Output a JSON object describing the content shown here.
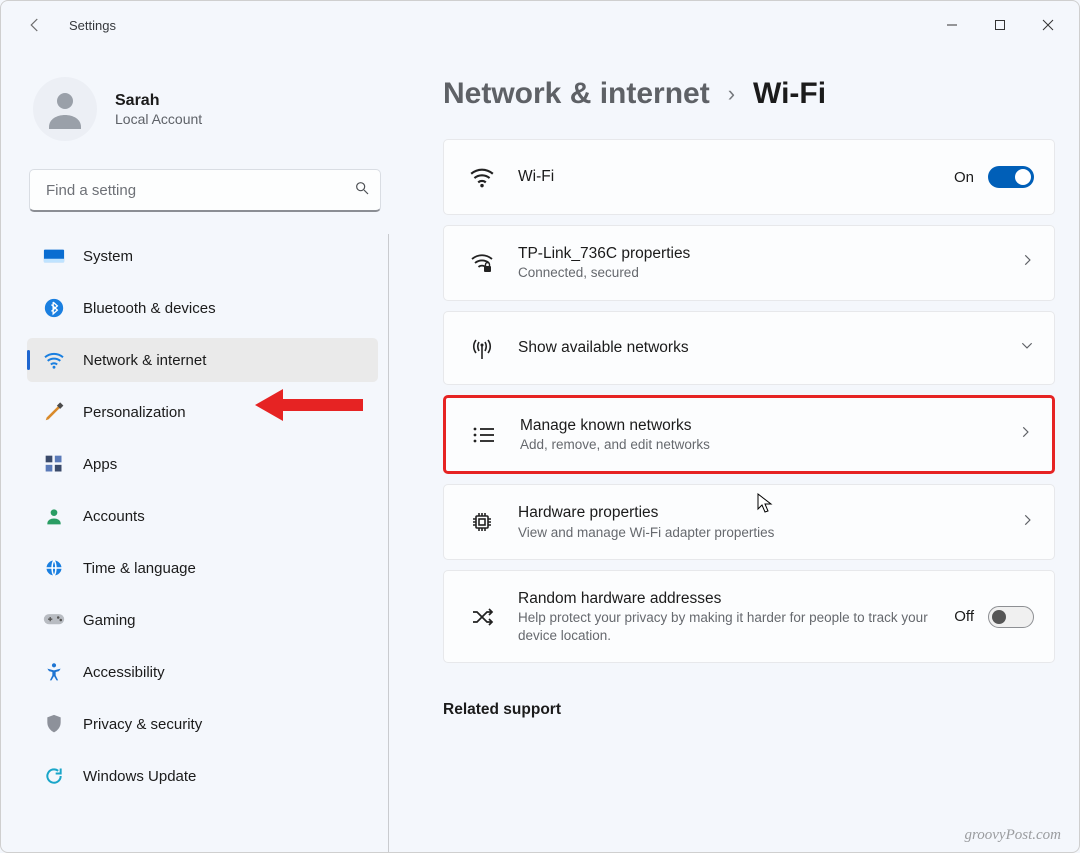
{
  "window": {
    "app_title": "Settings"
  },
  "account": {
    "name": "Sarah",
    "sub": "Local Account"
  },
  "search": {
    "placeholder": "Find a setting"
  },
  "nav": {
    "items": [
      {
        "label": "System",
        "icon": "system-icon",
        "selected": false
      },
      {
        "label": "Bluetooth & devices",
        "icon": "bluetooth-icon",
        "selected": false
      },
      {
        "label": "Network & internet",
        "icon": "wifi-icon",
        "selected": true
      },
      {
        "label": "Personalization",
        "icon": "personalization-icon",
        "selected": false
      },
      {
        "label": "Apps",
        "icon": "apps-icon",
        "selected": false
      },
      {
        "label": "Accounts",
        "icon": "accounts-icon",
        "selected": false
      },
      {
        "label": "Time & language",
        "icon": "time-language-icon",
        "selected": false
      },
      {
        "label": "Gaming",
        "icon": "gaming-icon",
        "selected": false
      },
      {
        "label": "Accessibility",
        "icon": "accessibility-icon",
        "selected": false
      },
      {
        "label": "Privacy & security",
        "icon": "privacy-icon",
        "selected": false
      },
      {
        "label": "Windows Update",
        "icon": "update-icon",
        "selected": false
      }
    ]
  },
  "breadcrumb": {
    "parent": "Network & internet",
    "current": "Wi-Fi"
  },
  "cards": {
    "wifi": {
      "title": "Wi-Fi",
      "state_label": "On",
      "toggle_on": true
    },
    "props": {
      "title": "TP-Link_736C properties",
      "sub": "Connected, secured"
    },
    "avail": {
      "title": "Show available networks"
    },
    "known": {
      "title": "Manage known networks",
      "sub": "Add, remove, and edit networks"
    },
    "hw": {
      "title": "Hardware properties",
      "sub": "View and manage Wi-Fi adapter properties"
    },
    "random": {
      "title": "Random hardware addresses",
      "sub": "Help protect your privacy by making it harder for people to track your device location.",
      "state_label": "Off",
      "toggle_on": false
    }
  },
  "related": {
    "heading": "Related support"
  },
  "watermark": "groovyPost.com"
}
